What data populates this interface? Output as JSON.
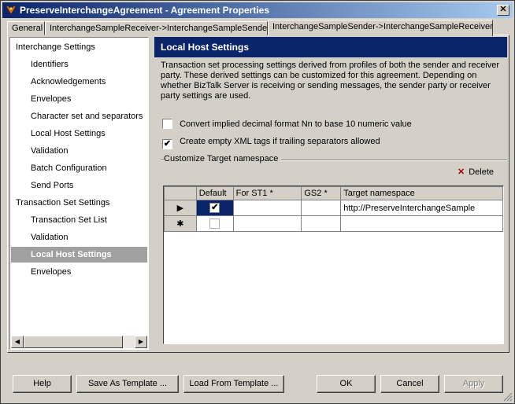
{
  "window": {
    "title": "PreserveInterchangeAgreement - Agreement Properties",
    "close_glyph": "✕"
  },
  "tabs": [
    {
      "label": "General"
    },
    {
      "label": "InterchangeSampleReceiver->InterchangeSampleSender"
    },
    {
      "label": "InterchangeSampleSender->InterchangeSampleReceiver"
    }
  ],
  "tree": {
    "items": [
      {
        "label": "Interchange Settings"
      },
      {
        "label": "Identifiers"
      },
      {
        "label": "Acknowledgements"
      },
      {
        "label": "Envelopes"
      },
      {
        "label": "Character set and separators"
      },
      {
        "label": "Local Host Settings"
      },
      {
        "label": "Validation"
      },
      {
        "label": "Batch Configuration"
      },
      {
        "label": "Send Ports"
      },
      {
        "label": "Transaction Set Settings"
      },
      {
        "label": "Transaction Set List"
      },
      {
        "label": "Validation"
      },
      {
        "label": "Local Host Settings"
      },
      {
        "label": "Envelopes"
      }
    ],
    "scroll_left": "◀",
    "scroll_right": "▶"
  },
  "panel": {
    "title": "Local Host Settings",
    "description": "Transaction set processing settings derived from profiles of both the sender and receiver party. These derived settings can be customized for this agreement. Depending on whether BizTalk Server is receiving or sending messages, the sender party or receiver party settings are used.",
    "options": [
      {
        "label": "Convert implied decimal format Nn to base 10 numeric value",
        "checked": false
      },
      {
        "label": "Create empty XML tags if trailing separators allowed",
        "checked": true
      }
    ],
    "group_label": "Customize Target namespace",
    "delete_label": "Delete",
    "grid": {
      "columns": [
        "Default",
        "For ST1 *",
        "GS2 *",
        "Target namespace"
      ],
      "rows": [
        {
          "marker": "▶",
          "default_checked": true,
          "st1": "",
          "gs2": "",
          "namespace": "http://PreserveInterchangeSample"
        },
        {
          "marker": "✱",
          "default_checked": false,
          "st1": "",
          "gs2": "",
          "namespace": ""
        }
      ]
    }
  },
  "buttons": {
    "help": "Help",
    "save_template": "Save As Template ...",
    "load_template": "Load From Template ...",
    "ok": "OK",
    "cancel": "Cancel",
    "apply": "Apply"
  },
  "check_glyph": "✔"
}
